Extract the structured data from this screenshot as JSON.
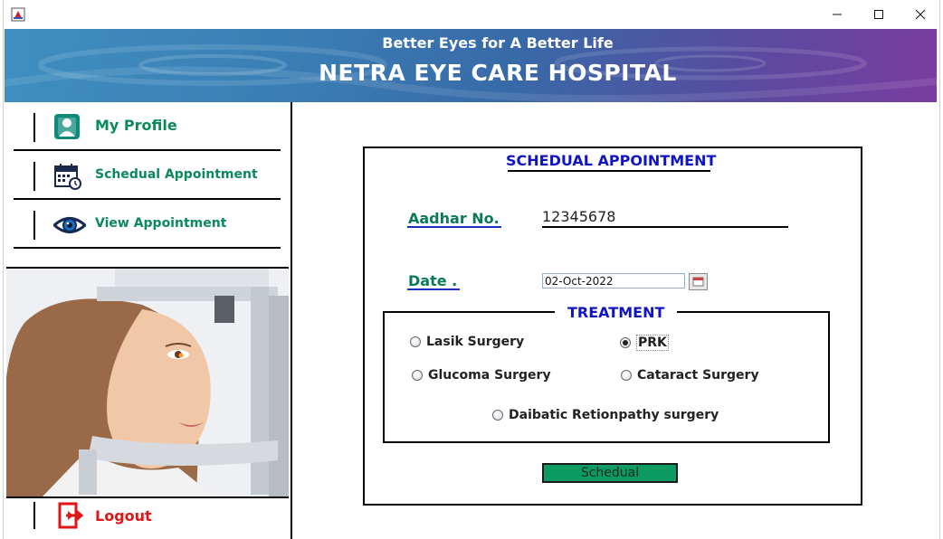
{
  "window": {
    "icon": "java-app-icon"
  },
  "banner": {
    "tagline": "Better Eyes for A Better Life",
    "hospital_name": "NETRA EYE CARE HOSPITAL"
  },
  "sidebar": {
    "items": [
      {
        "label": "My Profile",
        "icon": "profile-icon"
      },
      {
        "label": "Schedual Appointment",
        "icon": "calendar-icon"
      },
      {
        "label": "View Appointment",
        "icon": "eye-icon"
      }
    ],
    "logout": {
      "label": "Logout",
      "icon": "logout-icon"
    }
  },
  "form": {
    "title": "SCHEDUAL APPOINTMENT",
    "aadhar_label": "Aadhar No.",
    "aadhar_value": "12345678",
    "date_label": "Date .",
    "date_value": "02-Oct-2022",
    "treatment_legend": "TREATMENT",
    "treatments": [
      {
        "label": "Lasik Surgery",
        "selected": false
      },
      {
        "label": "PRK",
        "selected": true
      },
      {
        "label": "Glucoma Surgery",
        "selected": false
      },
      {
        "label": "Cataract Surgery",
        "selected": false
      },
      {
        "label": "Daibatic Retionpathy surgery",
        "selected": false
      }
    ],
    "submit_label": "Schedual"
  },
  "colors": {
    "nav_green": "#0a8a5a",
    "heading_blue": "#1014c4",
    "logout_red": "#e01616",
    "button_green": "#0a9a62"
  }
}
